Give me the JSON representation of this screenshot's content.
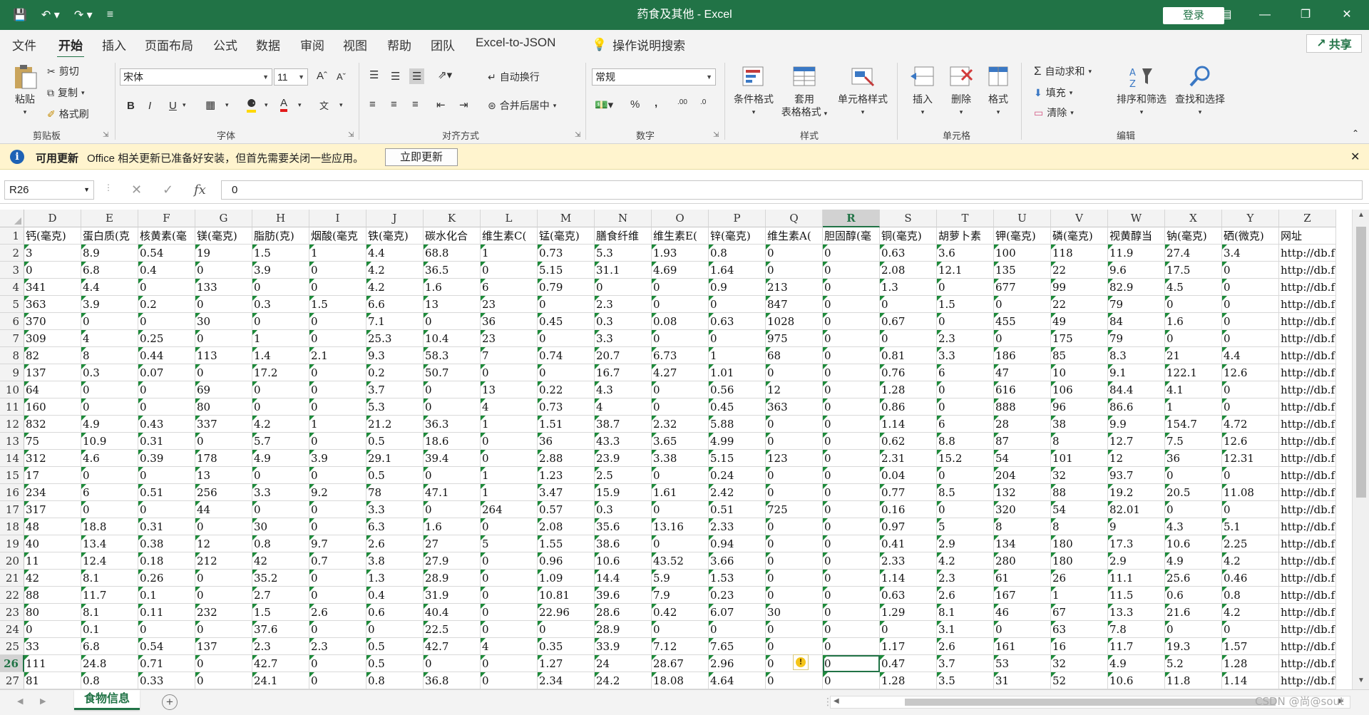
{
  "window": {
    "title": "药食及其他 - Excel",
    "login_label": "登录"
  },
  "menu": {
    "tabs": [
      "文件",
      "开始",
      "插入",
      "页面布局",
      "公式",
      "数据",
      "审阅",
      "视图",
      "帮助",
      "团队",
      "Excel-to-JSON"
    ],
    "active_tab": "开始",
    "tellme": "操作说明搜索",
    "share": "共享"
  },
  "ribbon": {
    "clipboard": {
      "paste": "粘贴",
      "cut": "剪切",
      "copy": "复制",
      "format_painter": "格式刷",
      "label": "剪贴板"
    },
    "font": {
      "name": "宋体",
      "size": "11",
      "label": "字体"
    },
    "alignment": {
      "wrap": "自动换行",
      "merge": "合并后居中",
      "label": "对齐方式"
    },
    "number": {
      "format": "常规",
      "label": "数字"
    },
    "styles": {
      "conditional": "条件格式",
      "table_line1": "套用",
      "table_line2": "表格格式",
      "cell_styles": "单元格样式",
      "label": "样式"
    },
    "cells": {
      "insert": "插入",
      "delete": "删除",
      "format": "格式",
      "label": "单元格"
    },
    "editing": {
      "autosum": "自动求和",
      "fill": "填充",
      "clear": "清除",
      "sort": "排序和筛选",
      "find": "查找和选择",
      "label": "编辑"
    }
  },
  "notification": {
    "title": "可用更新",
    "message": "Office 相关更新已准备好安装，但首先需要关闭一些应用。",
    "button": "立即更新"
  },
  "formula_bar": {
    "name_box": "R26",
    "fx": "fx",
    "value": "0"
  },
  "sheet": {
    "columns": [
      "D",
      "E",
      "F",
      "G",
      "H",
      "I",
      "J",
      "K",
      "L",
      "M",
      "N",
      "O",
      "P",
      "Q",
      "R",
      "S",
      "T",
      "U",
      "V",
      "W",
      "X",
      "Y",
      "Z"
    ],
    "selected_column": "R",
    "selected_row": "26",
    "rows": [
      {
        "n": "1",
        "cells": [
          "钙(毫克)",
          "蛋白质(克",
          "核黄素(毫",
          "镁(毫克)",
          "脂肪(克)",
          "烟酸(毫克",
          "铁(毫克)",
          "碳水化合",
          "维生素C(",
          "锰(毫克)",
          "膳食纤维",
          "维生素E(",
          "锌(毫克)",
          "维生素A(",
          "胆固醇(毫",
          "铜(毫克)",
          "胡萝卜素",
          "钾(毫克)",
          "磷(毫克)",
          "视黄醇当",
          "钠(毫克)",
          "硒(微克)",
          "网址"
        ]
      },
      {
        "n": "2",
        "cells": [
          "3",
          "8.9",
          "0.54",
          "19",
          "1.5",
          "1",
          "4.4",
          "68.8",
          "1",
          "0.73",
          "5.3",
          "1.93",
          "0.8",
          "0",
          "0",
          "0.63",
          "3.6",
          "100",
          "118",
          "11.9",
          "27.4",
          "3.4",
          "http://db.f"
        ]
      },
      {
        "n": "3",
        "cells": [
          "0",
          "6.8",
          "0.4",
          "0",
          "3.9",
          "0",
          "4.2",
          "36.5",
          "0",
          "5.15",
          "31.1",
          "4.69",
          "1.64",
          "0",
          "0",
          "2.08",
          "12.1",
          "135",
          "22",
          "9.6",
          "17.5",
          "0",
          "http://db.f"
        ]
      },
      {
        "n": "4",
        "cells": [
          "341",
          "4.4",
          "0",
          "133",
          "0",
          "0",
          "4.2",
          "1.6",
          "6",
          "0.79",
          "0",
          "0",
          "0.9",
          "213",
          "0",
          "1.3",
          "0",
          "677",
          "99",
          "82.9",
          "4.5",
          "0",
          "http://db.f"
        ]
      },
      {
        "n": "5",
        "cells": [
          "363",
          "3.9",
          "0.2",
          "0",
          "0.3",
          "1.5",
          "6.6",
          "13",
          "23",
          "0",
          "2.3",
          "0",
          "0",
          "847",
          "0",
          "0",
          "1.5",
          "0",
          "22",
          "79",
          "0",
          "0",
          "http://db.f"
        ]
      },
      {
        "n": "6",
        "cells": [
          "370",
          "0",
          "0",
          "30",
          "0",
          "0",
          "7.1",
          "0",
          "36",
          "0.45",
          "0.3",
          "0.08",
          "0.63",
          "1028",
          "0",
          "0.67",
          "0",
          "455",
          "49",
          "84",
          "1.6",
          "0",
          "http://db.f"
        ]
      },
      {
        "n": "7",
        "cells": [
          "309",
          "4",
          "0.25",
          "0",
          "1",
          "0",
          "25.3",
          "10.4",
          "23",
          "0",
          "3.3",
          "0",
          "0",
          "975",
          "0",
          "0",
          "2.3",
          "0",
          "175",
          "79",
          "0",
          "0",
          "http://db.f"
        ]
      },
      {
        "n": "8",
        "cells": [
          "82",
          "8",
          "0.44",
          "113",
          "1.4",
          "2.1",
          "9.3",
          "58.3",
          "7",
          "0.74",
          "20.7",
          "6.73",
          "1",
          "68",
          "0",
          "0.81",
          "3.3",
          "186",
          "85",
          "8.3",
          "21",
          "4.4",
          "http://db.f"
        ]
      },
      {
        "n": "9",
        "cells": [
          "137",
          "0.3",
          "0.07",
          "0",
          "17.2",
          "0",
          "0.2",
          "50.7",
          "0",
          "0",
          "16.7",
          "4.27",
          "1.01",
          "0",
          "0",
          "0.76",
          "6",
          "47",
          "10",
          "9.1",
          "122.1",
          "12.6",
          "http://db.f"
        ]
      },
      {
        "n": "10",
        "cells": [
          "64",
          "0",
          "0",
          "69",
          "0",
          "0",
          "3.7",
          "0",
          "13",
          "0.22",
          "4.3",
          "0",
          "0.56",
          "12",
          "0",
          "1.28",
          "0",
          "616",
          "106",
          "84.4",
          "4.1",
          "0",
          "http://db.f"
        ]
      },
      {
        "n": "11",
        "cells": [
          "160",
          "0",
          "0",
          "80",
          "0",
          "0",
          "5.3",
          "0",
          "4",
          "0.73",
          "4",
          "0",
          "0.45",
          "363",
          "0",
          "0.86",
          "0",
          "888",
          "96",
          "86.6",
          "1",
          "0",
          "http://db.f"
        ]
      },
      {
        "n": "12",
        "cells": [
          "832",
          "4.9",
          "0.43",
          "337",
          "4.2",
          "1",
          "21.2",
          "36.3",
          "1",
          "1.51",
          "38.7",
          "2.32",
          "5.88",
          "0",
          "0",
          "1.14",
          "6",
          "28",
          "38",
          "9.9",
          "154.7",
          "4.72",
          "http://db.f"
        ]
      },
      {
        "n": "13",
        "cells": [
          "75",
          "10.9",
          "0.31",
          "0",
          "5.7",
          "0",
          "0.5",
          "18.6",
          "0",
          "36",
          "43.3",
          "3.65",
          "4.99",
          "0",
          "0",
          "0.62",
          "8.8",
          "87",
          "8",
          "12.7",
          "7.5",
          "12.6",
          "http://db.f"
        ]
      },
      {
        "n": "14",
        "cells": [
          "312",
          "4.6",
          "0.39",
          "178",
          "4.9",
          "3.9",
          "29.1",
          "39.4",
          "0",
          "2.88",
          "23.9",
          "3.38",
          "5.15",
          "123",
          "0",
          "2.31",
          "15.2",
          "54",
          "101",
          "12",
          "36",
          "12.31",
          "http://db.f"
        ]
      },
      {
        "n": "15",
        "cells": [
          "17",
          "0",
          "0",
          "13",
          "0",
          "0",
          "0.5",
          "0",
          "1",
          "1.23",
          "2.5",
          "0",
          "0.24",
          "0",
          "0",
          "0.04",
          "0",
          "204",
          "32",
          "93.7",
          "0",
          "0",
          "http://db.f"
        ]
      },
      {
        "n": "16",
        "cells": [
          "234",
          "6",
          "0.51",
          "256",
          "3.3",
          "9.2",
          "78",
          "47.1",
          "1",
          "3.47",
          "15.9",
          "1.61",
          "2.42",
          "0",
          "0",
          "0.77",
          "8.5",
          "132",
          "88",
          "19.2",
          "20.5",
          "11.08",
          "http://db.f"
        ]
      },
      {
        "n": "17",
        "cells": [
          "317",
          "0",
          "0",
          "44",
          "0",
          "0",
          "3.3",
          "0",
          "264",
          "0.57",
          "0.3",
          "0",
          "0.51",
          "725",
          "0",
          "0.16",
          "0",
          "320",
          "54",
          "82.01",
          "0",
          "0",
          "http://db.f"
        ]
      },
      {
        "n": "18",
        "cells": [
          "48",
          "18.8",
          "0.31",
          "0",
          "30",
          "0",
          "6.3",
          "1.6",
          "0",
          "2.08",
          "35.6",
          "13.16",
          "2.33",
          "0",
          "0",
          "0.97",
          "5",
          "8",
          "8",
          "9",
          "4.3",
          "5.1",
          "http://db.f"
        ]
      },
      {
        "n": "19",
        "cells": [
          "40",
          "13.4",
          "0.38",
          "12",
          "0.8",
          "9.7",
          "2.6",
          "27",
          "5",
          "1.55",
          "38.6",
          "0",
          "0.94",
          "0",
          "0",
          "0.41",
          "2.9",
          "134",
          "180",
          "17.3",
          "10.6",
          "2.25",
          "http://db.f"
        ]
      },
      {
        "n": "20",
        "cells": [
          "11",
          "12.4",
          "0.18",
          "212",
          "42",
          "0.7",
          "3.8",
          "27.9",
          "0",
          "0.96",
          "10.6",
          "43.52",
          "3.66",
          "0",
          "0",
          "2.33",
          "4.2",
          "280",
          "180",
          "2.9",
          "4.9",
          "4.2",
          "http://db.f"
        ]
      },
      {
        "n": "21",
        "cells": [
          "42",
          "8.1",
          "0.26",
          "0",
          "35.2",
          "0",
          "1.3",
          "28.9",
          "0",
          "1.09",
          "14.4",
          "5.9",
          "1.53",
          "0",
          "0",
          "1.14",
          "2.3",
          "61",
          "26",
          "11.1",
          "25.6",
          "0.46",
          "http://db.f"
        ]
      },
      {
        "n": "22",
        "cells": [
          "88",
          "11.7",
          "0.1",
          "0",
          "2.7",
          "0",
          "0.4",
          "31.9",
          "0",
          "10.81",
          "39.6",
          "7.9",
          "0.23",
          "0",
          "0",
          "0.63",
          "2.6",
          "167",
          "1",
          "11.5",
          "0.6",
          "0.8",
          "http://db.f"
        ]
      },
      {
        "n": "23",
        "cells": [
          "80",
          "8.1",
          "0.11",
          "232",
          "1.5",
          "2.6",
          "0.6",
          "40.4",
          "0",
          "22.96",
          "28.6",
          "0.42",
          "6.07",
          "30",
          "0",
          "1.29",
          "8.1",
          "46",
          "67",
          "13.3",
          "21.6",
          "4.2",
          "http://db.f"
        ]
      },
      {
        "n": "24",
        "cells": [
          "0",
          "0.1",
          "0",
          "0",
          "37.6",
          "0",
          "0",
          "22.5",
          "0",
          "0",
          "28.9",
          "0",
          "0",
          "0",
          "0",
          "0",
          "3.1",
          "0",
          "63",
          "7.8",
          "0",
          "0",
          "http://db.f"
        ]
      },
      {
        "n": "25",
        "cells": [
          "33",
          "6.8",
          "0.54",
          "137",
          "2.3",
          "2.3",
          "0.5",
          "42.7",
          "4",
          "0.35",
          "33.9",
          "7.12",
          "7.65",
          "0",
          "0",
          "1.17",
          "2.6",
          "161",
          "16",
          "11.7",
          "19.3",
          "1.57",
          "http://db.f"
        ]
      },
      {
        "n": "26",
        "cells": [
          "111",
          "24.8",
          "0.71",
          "0",
          "42.7",
          "0",
          "0.5",
          "0",
          "0",
          "1.27",
          "24",
          "28.67",
          "2.96",
          "0",
          "0",
          "0.47",
          "3.7",
          "53",
          "32",
          "4.9",
          "5.2",
          "1.28",
          "http://db.f"
        ]
      },
      {
        "n": "27",
        "cells": [
          "81",
          "0.8",
          "0.33",
          "0",
          "24.1",
          "0",
          "0.8",
          "36.8",
          "0",
          "2.34",
          "24.2",
          "18.08",
          "4.64",
          "0",
          "0",
          "1.28",
          "3.5",
          "31",
          "52",
          "10.6",
          "11.8",
          "1.14",
          "http://db.f"
        ]
      }
    ],
    "tab_name": "食物信息"
  },
  "watermark": "CSDN @尚@sout",
  "colors": {
    "brand": "#217346",
    "notify_bg": "#fff4ce",
    "error_triangle": "#1d8a3a"
  }
}
